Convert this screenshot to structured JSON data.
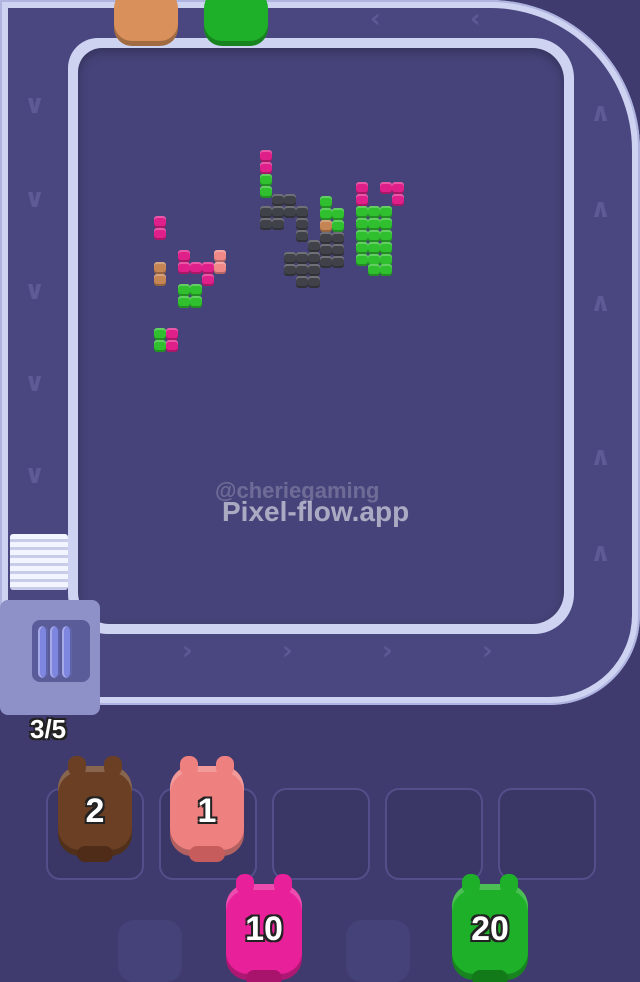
{
  "watermark": {
    "handle": "@cheriegaming",
    "site": "Pixel-flow.app"
  },
  "queue": {
    "capacity_text": "3/5"
  },
  "slots": [
    {
      "count": "2",
      "color": "#6b3f24"
    },
    {
      "count": "1",
      "color": "#ef8080"
    },
    {
      "count": "",
      "color": ""
    },
    {
      "count": "",
      "color": ""
    },
    {
      "count": "",
      "color": ""
    }
  ],
  "waiting": [
    {
      "count": "10",
      "color": "#e8209a"
    },
    {
      "count": "20",
      "color": "#1fb02a"
    }
  ],
  "top_characters": [
    {
      "color": "#d9905a",
      "name": "orange-pig-icon"
    },
    {
      "color": "#1fb02a",
      "name": "green-pig-icon"
    }
  ],
  "colors": {
    "background": "#3f3b6e",
    "track": "#cfd3f2",
    "belt": "#4a4780",
    "board": "#46437a",
    "green": "#2fbf2f",
    "magenta": "#e0208a",
    "dark": "#40424a",
    "pink": "#f08888",
    "orange": "#c48454"
  }
}
